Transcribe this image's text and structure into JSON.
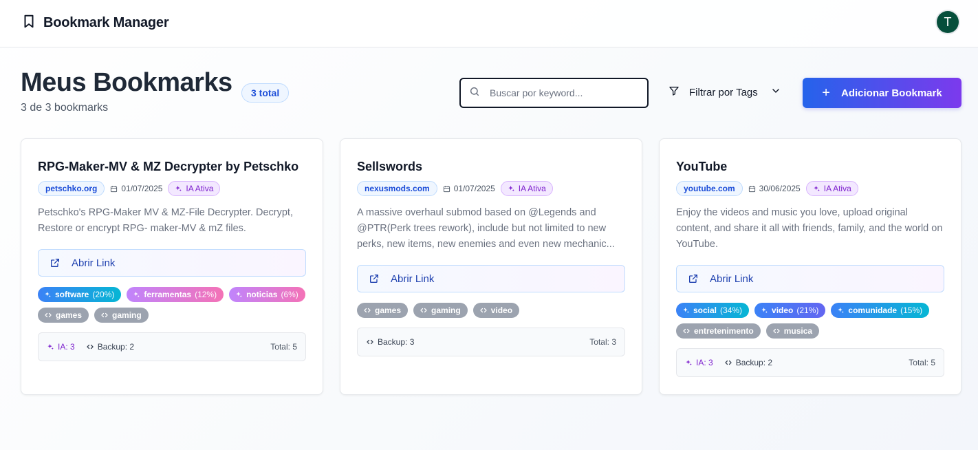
{
  "header": {
    "title": "Bookmark Manager",
    "avatar_letter": "T"
  },
  "page": {
    "title": "Meus Bookmarks",
    "count_badge": "3 total",
    "subtitle": "3 de 3 bookmarks"
  },
  "search": {
    "placeholder": "Buscar por keyword...",
    "value": ""
  },
  "filter": {
    "label": "Filtrar por Tags"
  },
  "add_button": {
    "label": "Adicionar Bookmark"
  },
  "open_link_label": "Abrir Link",
  "cards": [
    {
      "title": "RPG-Maker-MV & MZ Decrypter by Petschko",
      "domain": "petschko.org",
      "date": "01/07/2025",
      "ia_badge": "IA Ativa",
      "description": "Petschko's RPG-Maker MV & MZ-File Decrypter. Decrypt, Restore or encrypt RPG- maker-MV & mZ files.",
      "tags": [
        {
          "name": "software",
          "pct": "(20%)",
          "kind": "ai",
          "color": "blue-cyan"
        },
        {
          "name": "ferramentas",
          "pct": "(12%)",
          "kind": "ai",
          "color": "purple-pink"
        },
        {
          "name": "noticias",
          "pct": "(6%)",
          "kind": "ai",
          "color": "purple-pink"
        },
        {
          "name": "games",
          "pct": "",
          "kind": "backup",
          "color": "gray"
        },
        {
          "name": "gaming",
          "pct": "",
          "kind": "backup",
          "color": "gray"
        }
      ],
      "footer": {
        "ia": "IA: 3",
        "backup": "Backup: 2",
        "total": "Total: 5"
      }
    },
    {
      "title": "Sellswords",
      "domain": "nexusmods.com",
      "date": "01/07/2025",
      "ia_badge": "IA Ativa",
      "description": "A massive overhaul submod based on @Legends and @PTR(Perk trees rework), include but not limited to new perks, new items, new enemies and even new mechanic...",
      "tags": [
        {
          "name": "games",
          "pct": "",
          "kind": "backup",
          "color": "gray"
        },
        {
          "name": "gaming",
          "pct": "",
          "kind": "backup",
          "color": "gray"
        },
        {
          "name": "video",
          "pct": "",
          "kind": "backup",
          "color": "gray"
        }
      ],
      "footer": {
        "ia": "",
        "backup": "Backup: 3",
        "total": "Total: 3"
      }
    },
    {
      "title": "YouTube",
      "domain": "youtube.com",
      "date": "30/06/2025",
      "ia_badge": "IA Ativa",
      "description": "Enjoy the videos and music you love, upload original content, and share it all with friends, family, and the world on YouTube.",
      "tags": [
        {
          "name": "social",
          "pct": "(34%)",
          "kind": "ai",
          "color": "blue-cyan"
        },
        {
          "name": "video",
          "pct": "(21%)",
          "kind": "ai",
          "color": "blue-indigo"
        },
        {
          "name": "comunidade",
          "pct": "(15%)",
          "kind": "ai",
          "color": "blue-cyan"
        },
        {
          "name": "entretenimento",
          "pct": "",
          "kind": "backup",
          "color": "gray"
        },
        {
          "name": "musica",
          "pct": "",
          "kind": "backup",
          "color": "gray"
        }
      ],
      "footer": {
        "ia": "IA: 3",
        "backup": "Backup: 2",
        "total": "Total: 5"
      }
    }
  ]
}
